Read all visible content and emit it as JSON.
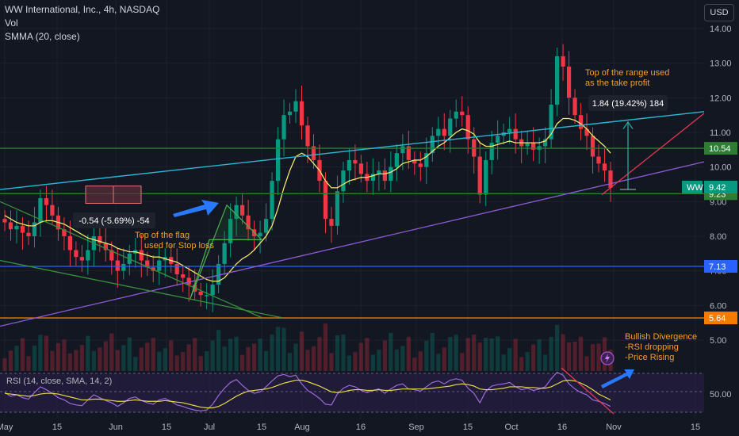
{
  "header": {
    "symbol_line": "WW International, Inc., 4h, NASDAQ",
    "volume_label": "Vol",
    "smma_label": "SMMA (20, close)"
  },
  "currency_button": "USD",
  "rsi_label": "RSI (14, close, SMA, 14, 2)",
  "chart_data": {
    "type": "candlestick",
    "price_axis": {
      "ticks": [
        "14.00",
        "13.00",
        "12.00",
        "11.00",
        "10.00",
        "9.00",
        "8.00",
        "7.00",
        "6.00",
        "5.00"
      ],
      "range": [
        4.55,
        14.35
      ]
    },
    "rsi_axis": {
      "ticks": [
        "50.00"
      ]
    },
    "time_axis": {
      "ticks": [
        "May",
        "15",
        "Jun",
        "15",
        "Jul",
        "15",
        "Aug",
        "16",
        "Sep",
        "15",
        "Oct",
        "16",
        "Nov",
        "15"
      ]
    },
    "closes": [
      8.4,
      8.2,
      8.3,
      8.1,
      8.0,
      8.4,
      9.1,
      8.9,
      8.6,
      8.2,
      8.0,
      7.6,
      7.4,
      7.3,
      7.6,
      8.0,
      7.8,
      7.6,
      7.3,
      7.0,
      7.2,
      7.5,
      7.6,
      7.3,
      7.1,
      7.0,
      7.3,
      7.4,
      7.2,
      6.9,
      6.8,
      6.6,
      6.4,
      6.3,
      6.3,
      6.6,
      7.2,
      7.8,
      8.5,
      8.9,
      8.6,
      8.2,
      8.0,
      8.1,
      8.5,
      9.6,
      10.8,
      11.5,
      11.6,
      11.9,
      11.2,
      10.6,
      10.2,
      9.6,
      8.5,
      8.3,
      9.3,
      9.9,
      10.2,
      10.1,
      9.8,
      9.6,
      9.8,
      9.9,
      9.6,
      10.0,
      10.4,
      10.6,
      10.2,
      10.1,
      10.0,
      10.4,
      10.9,
      11.1,
      10.9,
      11.4,
      11.6,
      11.5,
      10.8,
      10.3,
      9.2,
      10.2,
      10.7,
      10.9,
      11.0,
      11.1,
      10.8,
      10.6,
      10.7,
      10.5,
      10.6,
      10.8,
      11.8,
      13.2,
      12.9,
      12.0,
      11.5,
      11.1,
      10.9,
      10.3,
      10.1,
      9.9,
      9.4
    ],
    "smma": [
      8.6,
      8.5,
      8.4,
      8.35,
      8.3,
      8.3,
      8.4,
      8.45,
      8.45,
      8.4,
      8.35,
      8.25,
      8.15,
      8.05,
      7.95,
      7.9,
      7.85,
      7.8,
      7.75,
      7.65,
      7.6,
      7.55,
      7.55,
      7.5,
      7.45,
      7.4,
      7.4,
      7.35,
      7.3,
      7.25,
      7.15,
      7.05,
      6.95,
      6.85,
      6.75,
      6.7,
      6.7,
      6.8,
      7.0,
      7.2,
      7.35,
      7.45,
      7.6,
      7.8,
      8.0,
      8.3,
      8.8,
      9.4,
      9.9,
      10.3,
      10.4,
      10.3,
      10.1,
      9.9,
      9.6,
      9.4,
      9.4,
      9.5,
      9.6,
      9.65,
      9.7,
      9.7,
      9.75,
      9.8,
      9.8,
      9.85,
      9.95,
      10.1,
      10.15,
      10.2,
      10.2,
      10.3,
      10.45,
      10.6,
      10.7,
      10.85,
      11.0,
      11.1,
      11.05,
      10.95,
      10.7,
      10.6,
      10.6,
      10.65,
      10.7,
      10.75,
      10.7,
      10.7,
      10.7,
      10.7,
      10.7,
      10.75,
      10.95,
      11.25,
      11.4,
      11.4,
      11.35,
      11.25,
      11.1,
      10.9,
      10.75,
      10.6,
      10.4
    ],
    "rsi": [
      52,
      47,
      49,
      45,
      43,
      52,
      60,
      56,
      51,
      45,
      42,
      37,
      35,
      34,
      42,
      49,
      45,
      41,
      38,
      33,
      38,
      44,
      46,
      41,
      38,
      36,
      42,
      44,
      40,
      35,
      33,
      30,
      28,
      27,
      28,
      36,
      48,
      58,
      66,
      70,
      62,
      55,
      51,
      53,
      60,
      68,
      75,
      77,
      74,
      76,
      64,
      55,
      50,
      44,
      36,
      35,
      50,
      58,
      62,
      60,
      55,
      52,
      55,
      57,
      51,
      57,
      62,
      64,
      57,
      56,
      54,
      60,
      66,
      68,
      64,
      69,
      71,
      69,
      58,
      51,
      38,
      54,
      61,
      63,
      64,
      66,
      60,
      56,
      58,
      55,
      57,
      60,
      71,
      80,
      76,
      64,
      57,
      52,
      49,
      42,
      40,
      37,
      33
    ],
    "rsi_sma": [
      51,
      50,
      49,
      48,
      47,
      48,
      50,
      51,
      51,
      50,
      48,
      46,
      44,
      42,
      42,
      43,
      43,
      42,
      41,
      40,
      40,
      41,
      42,
      41,
      40,
      40,
      40,
      41,
      40,
      39,
      38,
      36,
      34,
      32,
      31,
      31,
      33,
      37,
      42,
      47,
      51,
      54,
      55,
      56,
      57,
      59,
      62,
      65,
      67,
      69,
      69,
      67,
      64,
      61,
      57,
      53,
      52,
      53,
      55,
      56,
      56,
      55,
      55,
      56,
      55,
      55,
      56,
      57,
      57,
      57,
      57,
      57,
      58,
      59,
      60,
      61,
      63,
      64,
      63,
      61,
      57,
      56,
      56,
      57,
      58,
      60,
      60,
      60,
      59,
      59,
      58,
      58,
      60,
      64,
      68,
      69,
      68,
      65,
      61,
      56,
      50,
      46,
      42
    ]
  },
  "levels": {
    "r1": {
      "label": "10.54",
      "value": 10.54,
      "color": "#2e7d32"
    },
    "s1": {
      "label": "9.23",
      "value": 9.23,
      "color": "#2e7d32"
    },
    "blue": {
      "label": "7.13",
      "value": 7.13,
      "color": "#2962ff"
    },
    "orange": {
      "label": "5.64",
      "value": 5.64,
      "color": "#f57c00"
    }
  },
  "price_tag": {
    "ticker": "WW",
    "price": "9.42",
    "value": 9.42,
    "color": "#089981"
  },
  "measure_up": "1.84 (19.42%) 184",
  "measure_down": "-0.54 (-5.69%) -54",
  "annotations": {
    "take_profit": [
      "Top of the range used",
      "as the take profit"
    ],
    "stop_loss": [
      "Top of the flag",
      "used for Stop loss"
    ],
    "divergence": [
      "Bullish Divergence",
      "-RSI dropping",
      "-Price Rising"
    ]
  },
  "colors": {
    "up": "#089981",
    "down": "#f23645",
    "smma": "#f2e66b",
    "rsi": "#9c6ade",
    "rsi_sma": "#e8d84a",
    "channel_top": "#29b6d6",
    "trend_purple": "#8e5bd6",
    "flag_green": "#388e3c",
    "target_red": "#e53950"
  },
  "icons": {
    "alert": "lightning-icon",
    "arrows": "pointer-arrow-icon"
  }
}
